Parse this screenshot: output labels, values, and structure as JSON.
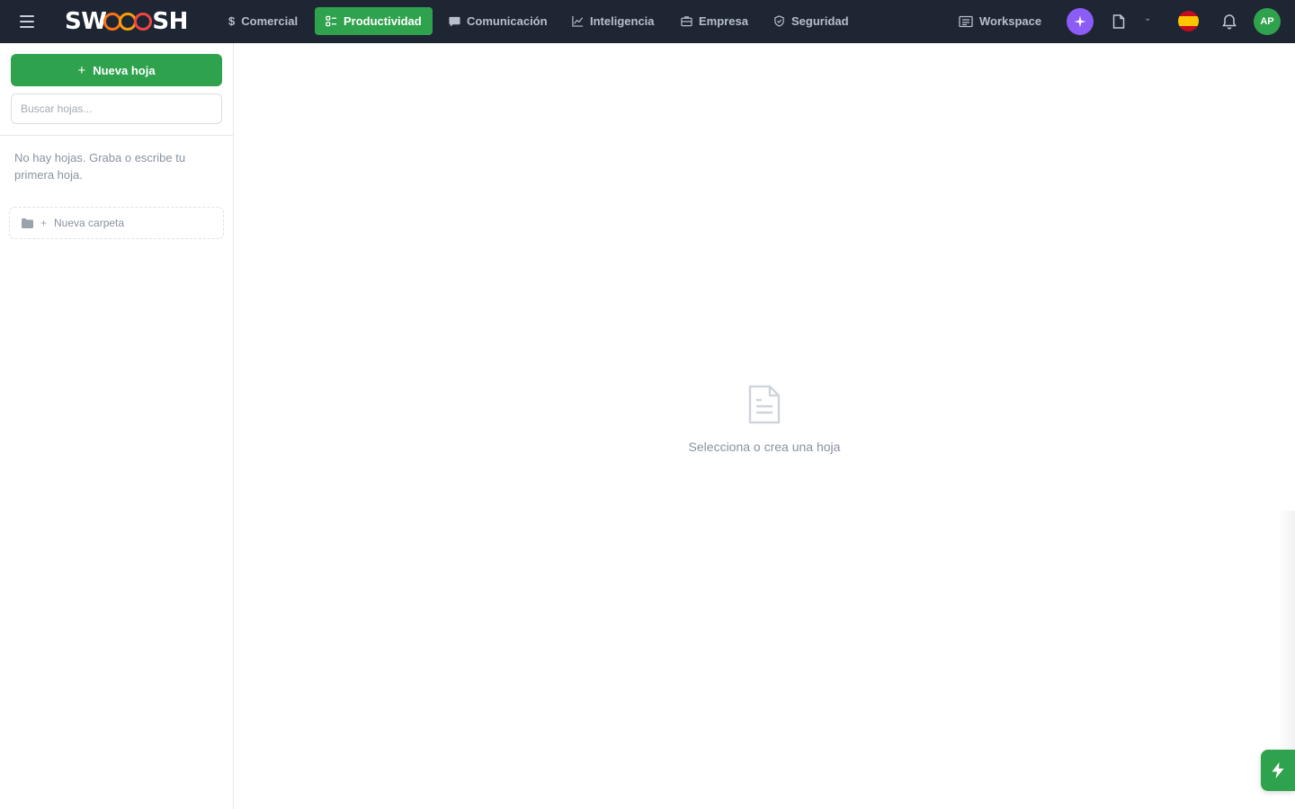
{
  "app": {
    "logo_text_left": "SW",
    "logo_text_right": "SH"
  },
  "nav": {
    "items": [
      {
        "label": "Comercial",
        "icon": "dollar-icon"
      },
      {
        "label": "Productividad",
        "icon": "checklist-icon",
        "active": true
      },
      {
        "label": "Comunicación",
        "icon": "chat-icon"
      },
      {
        "label": "Inteligencia",
        "icon": "chart-line-icon"
      },
      {
        "label": "Empresa",
        "icon": "briefcase-icon"
      },
      {
        "label": "Seguridad",
        "icon": "shield-icon"
      }
    ],
    "workspace_label": "Workspace",
    "avatar_initials": "AP",
    "language": "es"
  },
  "sidebar": {
    "new_button_label": "Nueva hoja",
    "search_placeholder": "Buscar hojas...",
    "empty_message": "No hay hojas. Graba o escribe tu primera hoja.",
    "new_folder_label": "Nueva carpeta"
  },
  "main": {
    "placeholder_text": "Selecciona o crea una hoja"
  },
  "colors": {
    "topbar": "#1e2533",
    "accent_green": "#2fa24d",
    "ai_purple": "#8b5cf6"
  }
}
